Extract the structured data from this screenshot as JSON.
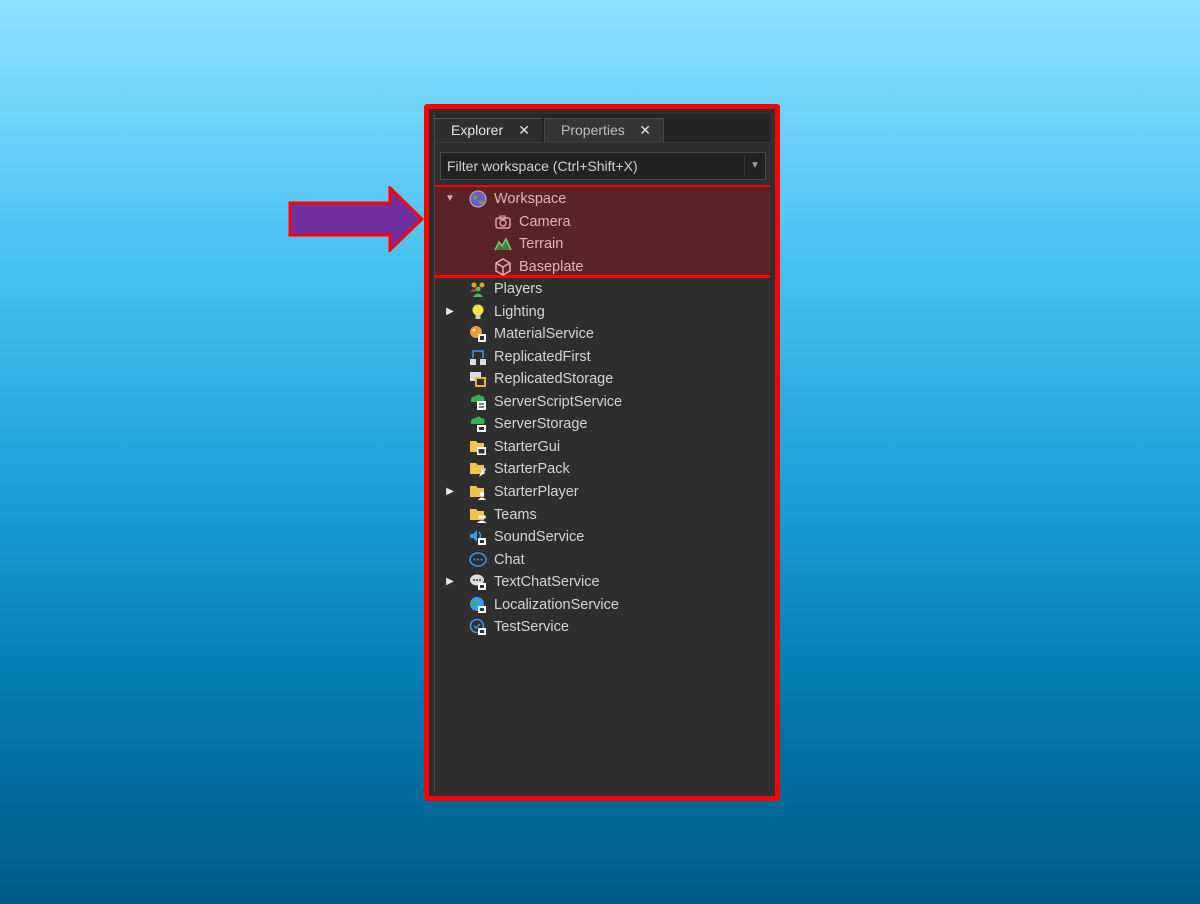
{
  "tabs": [
    {
      "label": "Explorer",
      "close": "✕",
      "active": true
    },
    {
      "label": "Properties",
      "close": "✕",
      "active": false
    }
  ],
  "filter": {
    "placeholder": "Filter workspace (Ctrl+Shift+X)",
    "caret": "▼"
  },
  "tree": {
    "workspace": {
      "label": "Workspace",
      "expander": "▼",
      "icon": "globe-icon",
      "children": [
        {
          "label": "Camera",
          "icon": "camera-icon"
        },
        {
          "label": "Terrain",
          "icon": "terrain-icon"
        },
        {
          "label": "Baseplate",
          "icon": "part-cube-icon"
        }
      ]
    },
    "services": [
      {
        "label": "Players",
        "icon": "players-icon",
        "expander": ""
      },
      {
        "label": "Lighting",
        "icon": "lightbulb-icon",
        "expander": "▶"
      },
      {
        "label": "MaterialService",
        "icon": "material-service-icon",
        "expander": ""
      },
      {
        "label": "ReplicatedFirst",
        "icon": "replicated-first-icon",
        "expander": ""
      },
      {
        "label": "ReplicatedStorage",
        "icon": "replicated-storage-icon",
        "expander": ""
      },
      {
        "label": "ServerScriptService",
        "icon": "server-script-service-icon",
        "expander": ""
      },
      {
        "label": "ServerStorage",
        "icon": "server-storage-icon",
        "expander": ""
      },
      {
        "label": "StarterGui",
        "icon": "starter-gui-icon",
        "expander": ""
      },
      {
        "label": "StarterPack",
        "icon": "starter-pack-icon",
        "expander": ""
      },
      {
        "label": "StarterPlayer",
        "icon": "starter-player-icon",
        "expander": "▶"
      },
      {
        "label": "Teams",
        "icon": "teams-icon",
        "expander": ""
      },
      {
        "label": "SoundService",
        "icon": "sound-service-icon",
        "expander": ""
      },
      {
        "label": "Chat",
        "icon": "chat-icon",
        "expander": ""
      },
      {
        "label": "TextChatService",
        "icon": "text-chat-service-icon",
        "expander": "▶"
      },
      {
        "label": "LocalizationService",
        "icon": "localization-service-icon",
        "expander": ""
      },
      {
        "label": "TestService",
        "icon": "test-service-icon",
        "expander": ""
      }
    ]
  },
  "colors": {
    "highlight_border": "#ff0000",
    "highlight_fill": "#5a2326",
    "pointer_arrow": "#7030a0",
    "panel_bg": "#2e2e2e"
  }
}
